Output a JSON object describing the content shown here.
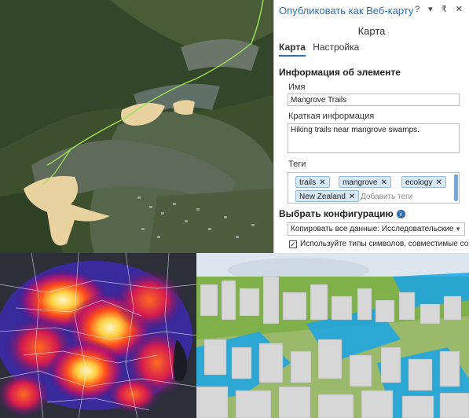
{
  "pane": {
    "title": "Опубликовать как Веб-карту",
    "controls": "? ▾ ₹ ✕",
    "subtitle": "Карта",
    "tabs": [
      {
        "label": "Карта",
        "active": true
      },
      {
        "label": "Настройка",
        "active": false
      }
    ],
    "item_info": {
      "heading": "Информация об элементе",
      "name_label": "Имя",
      "name_value": "Mangrove Trails",
      "summary_label": "Краткая информация",
      "summary_value": "Hiking trails near mangrove swamps.",
      "tags_label": "Теги",
      "tags": [
        "trails",
        "mangrove",
        "ecology",
        "New Zealand"
      ],
      "tag_placeholder": "Добавить теги"
    },
    "config": {
      "heading": "Выбрать конфигурацию",
      "info_icon": "i",
      "selected": "Копировать все данные: Исследовательские",
      "checkbox_label": "Используйте типы символов, совместимые со",
      "checkbox_checked": true
    }
  },
  "icons": {
    "info": "info-icon",
    "remove_tag": "close-icon",
    "dropdown": "chevron-down-icon"
  },
  "colors": {
    "accent": "#2b6fb5",
    "tag_bg": "#d7e8f6"
  }
}
